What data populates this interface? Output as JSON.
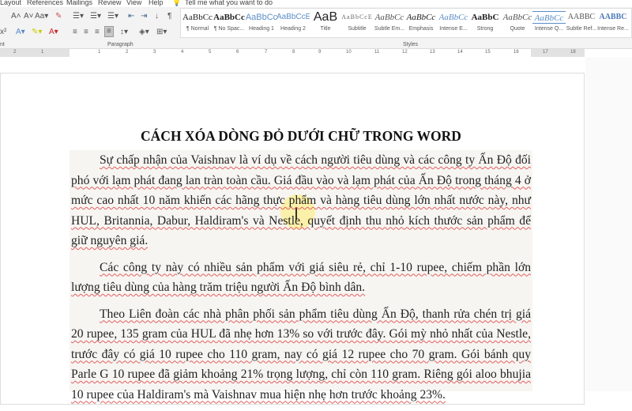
{
  "tabs": [
    "Layout",
    "References",
    "Mailings",
    "Review",
    "View",
    "Help",
    "Tell me what you want to do"
  ],
  "ribbon": {
    "groups": {
      "font_partial": "nt",
      "paragraph": "Paragraph",
      "styles": "Styles"
    }
  },
  "styles": [
    {
      "preview": "AaBbCc",
      "name": "¶ Normal"
    },
    {
      "preview": "AaBbCc",
      "name": "¶ No Spac..."
    },
    {
      "preview": "AaBbCc",
      "name": "Heading 1"
    },
    {
      "preview": "AaBbCcE",
      "name": "Heading 2"
    },
    {
      "preview": "AaB",
      "name": "Title"
    },
    {
      "preview": "AaBbCcE",
      "name": "Subtitle"
    },
    {
      "preview": "AaBbCc",
      "name": "Subtle Em..."
    },
    {
      "preview": "AaBbCc",
      "name": "Emphasis"
    },
    {
      "preview": "AaBbCc",
      "name": "Intense E..."
    },
    {
      "preview": "AaBbC",
      "name": "Strong"
    },
    {
      "preview": "AaBbCc",
      "name": "Quote"
    },
    {
      "preview": "AaBbCc",
      "name": "Intense Q..."
    },
    {
      "preview": "AABBC",
      "name": "Subtle Ref..."
    },
    {
      "preview": "AABBC",
      "name": "Intense Re..."
    }
  ],
  "ruler": [
    "2",
    "1",
    "1",
    "2",
    "3",
    "4",
    "5",
    "6",
    "7",
    "8",
    "9",
    "10",
    "11",
    "12",
    "13",
    "14",
    "15",
    "16",
    "17",
    "18"
  ],
  "document": {
    "title": "CÁCH XÓA DÒNG ĐỎ DƯỚI CHỮ TRONG WORD",
    "paragraphs": [
      "Sự chấp nhận của Vaishnav là ví dụ về cách người tiêu dùng và các công ty Ấn Độ đối phó với lạm phát đang lan tràn toàn cầu. Giá đầu vào và lạm phát của Ấn Độ trong tháng 4 ở mức cao nhất 10 năm khiến các hãng thực phẩm và hàng tiêu dùng lớn nhất nước này, như HUL, Britannia, Dabur, Haldiram's và Nestle, quyết định thu nhỏ kích thước sản phẩm để giữ nguyên giá.",
      "Các công ty này có nhiều sản phẩm với giá siêu rẻ, chỉ 1-10 rupee, chiếm phần lớn lượng tiêu dùng của hàng trăm triệu người Ấn Độ bình dân.",
      "Theo Liên đoàn các nhà phân phối sản phẩm tiêu dùng Ấn Độ, thanh rửa chén trị giá 20 rupee, 135 gram của HUL đã nhẹ hơn 13% so với trước đây. Gói mỳ nhỏ nhất của Nestle, trước đây có giá 10 rupee cho 110 gram, nay có giá 12 rupee cho 70 gram. Gói bánh quy Parle G 10 rupee đã giảm khoảng 21% trọng lượng, chỉ còn 110 gram. Riêng gói aloo bhujia 10 rupee của Haldiram's mà Vaishnav mua hiện nhẹ hơn trước khoảng 23%."
    ]
  }
}
